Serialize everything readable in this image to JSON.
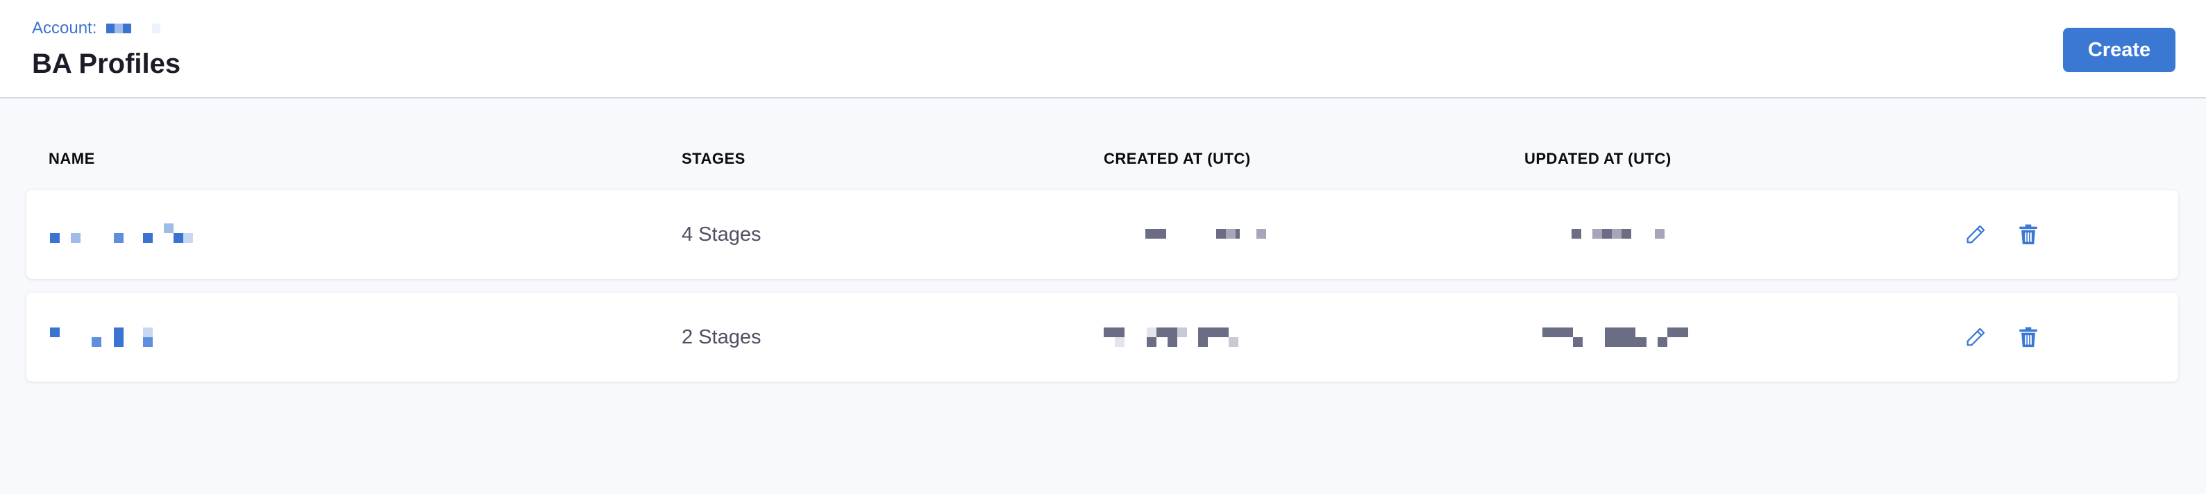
{
  "header": {
    "account_label": "Account:",
    "title": "BA Profiles",
    "create_label": "Create"
  },
  "table": {
    "columns": [
      "NAME",
      "STAGES",
      "CREATED AT (UTC)",
      "UPDATED AT (UTC)"
    ],
    "rows": [
      {
        "stages": "4 Stages"
      },
      {
        "stages": "2 Stages"
      }
    ]
  },
  "colors": {
    "accent": "#3a78d4",
    "link": "#3b73cf",
    "redacted_text": "#6b6d85",
    "page_bg": "#f8f9fd"
  },
  "icons": [
    "edit-pencil-icon",
    "trash-icon"
  ]
}
